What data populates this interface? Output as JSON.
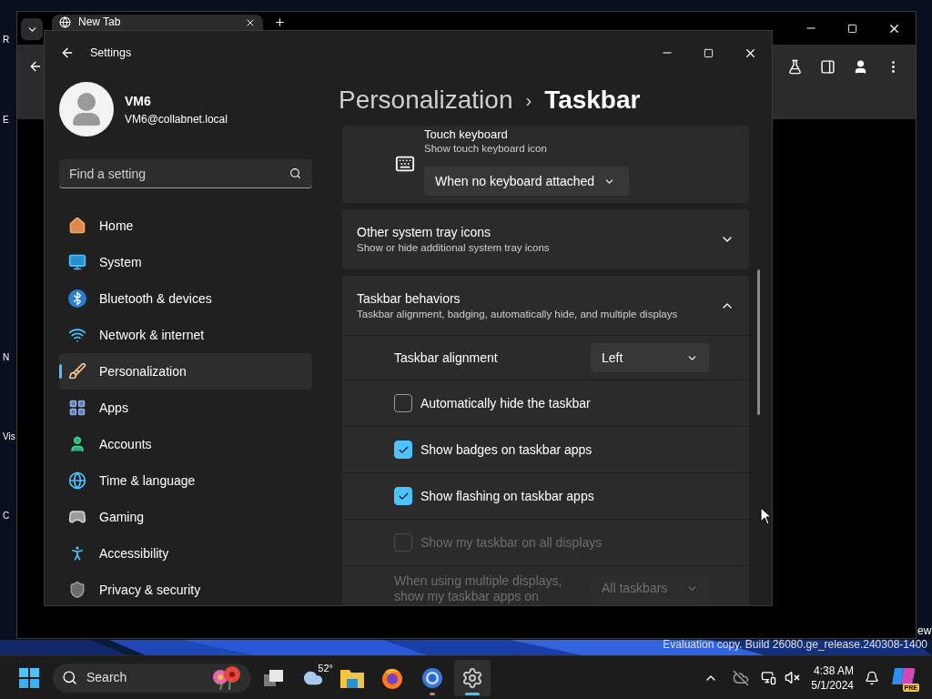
{
  "desktop": {
    "left_icon_labels": [
      "R",
      "E",
      "N",
      "Vis",
      "C"
    ],
    "right_icon_label": "ew",
    "watermark": "Evaluation copy. Build 26080.ge_release.240308-1400"
  },
  "browser": {
    "tab_title": "New Tab"
  },
  "settings": {
    "title": "Settings",
    "user": {
      "name": "VM6",
      "email": "VM6@collabnet.local"
    },
    "search": {
      "placeholder": "Find a setting"
    },
    "nav": [
      {
        "label": "Home",
        "selected": false
      },
      {
        "label": "System",
        "selected": false
      },
      {
        "label": "Bluetooth & devices",
        "selected": false
      },
      {
        "label": "Network & internet",
        "selected": false
      },
      {
        "label": "Personalization",
        "selected": true
      },
      {
        "label": "Apps",
        "selected": false
      },
      {
        "label": "Accounts",
        "selected": false
      },
      {
        "label": "Time & language",
        "selected": false
      },
      {
        "label": "Gaming",
        "selected": false
      },
      {
        "label": "Accessibility",
        "selected": false
      },
      {
        "label": "Privacy & security",
        "selected": false
      }
    ],
    "breadcrumb": {
      "parent": "Personalization",
      "separator": "›",
      "current": "Taskbar"
    },
    "cards": [
      {
        "kind": "dropdown",
        "title": "Touch keyboard",
        "subtitle": "Show touch keyboard icon",
        "value": "When no keyboard attached"
      },
      {
        "kind": "expander",
        "title": "Other system tray icons",
        "subtitle": "Show or hide additional system tray icons",
        "expanded": false
      },
      {
        "kind": "expander",
        "title": "Taskbar behaviors",
        "subtitle": "Taskbar alignment, badging, automatically hide, and multiple displays",
        "expanded": true,
        "rows": [
          {
            "kind": "dropdown",
            "label": "Taskbar alignment",
            "value": "Left",
            "disabled": false
          },
          {
            "kind": "checkbox",
            "label": "Automatically hide the taskbar",
            "checked": false,
            "disabled": false
          },
          {
            "kind": "checkbox",
            "label": "Show badges on taskbar apps",
            "checked": true,
            "disabled": false
          },
          {
            "kind": "checkbox",
            "label": "Show flashing on taskbar apps",
            "checked": true,
            "disabled": false
          },
          {
            "kind": "checkbox",
            "label": "Show my taskbar on all displays",
            "checked": false,
            "disabled": true
          },
          {
            "kind": "dropdown",
            "label": "When using multiple displays, show my taskbar apps on",
            "value": "All taskbars",
            "disabled": true
          }
        ]
      }
    ]
  },
  "taskbar": {
    "search_label": "Search",
    "weather": "52°",
    "apps": [
      {
        "running": false,
        "selected": false
      },
      {
        "running": false,
        "selected": false
      },
      {
        "running": false,
        "selected": false
      },
      {
        "running": true,
        "selected": false
      },
      {
        "running": true,
        "selected": true
      }
    ],
    "time": "4:38 AM",
    "date": "5/1/2024",
    "copilot_badge": "PRE"
  }
}
